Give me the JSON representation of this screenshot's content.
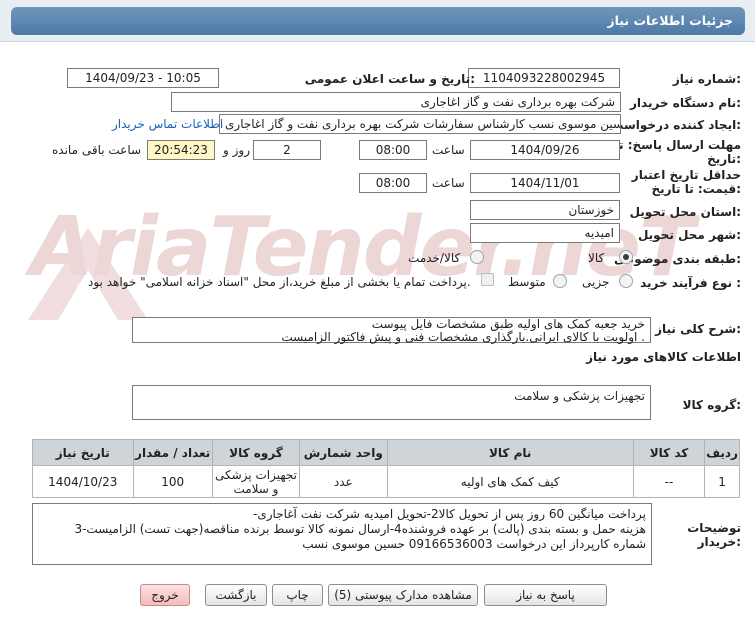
{
  "header": {
    "title": "جزئیات اطلاعات نیاز"
  },
  "watermark": {
    "text": "AriaTender.neT"
  },
  "form": {
    "need_number": {
      "label": "شماره نیاز:",
      "value": "1104093228002945"
    },
    "announce_datetime": {
      "label": "تاریخ و ساعت اعلان عمومی:",
      "value": "1404/09/23 - 10:05"
    },
    "buyer_org": {
      "label": "نام دستگاه خریدار:",
      "value": "شرکت بهره برداری نفت و گاز اغاجاری"
    },
    "requester": {
      "label": "ایجاد کننده درخواست:",
      "value": "حسین موسوی نسب کارشناس سفارشات شرکت بهره برداری نفت و گاز اغاجاری",
      "contact_link": "اطلاعات تماس خریدار"
    },
    "reply_deadline": {
      "label_line1": "مهلت ارسال پاسخ: تا",
      "label_line2": "تاریخ:",
      "date": "1404/09/26",
      "time_label": "ساعت",
      "time": "08:00",
      "days": "2",
      "days_label": "روز و",
      "remaining": "20:54:23",
      "remaining_label": "ساعت باقی مانده"
    },
    "price_validity": {
      "label_line1": "حداقل تاریخ اعتبار",
      "label_line2": "قیمت: تا تاریخ:",
      "date": "1404/11/01",
      "time_label": "ساعت",
      "time": "08:00"
    },
    "delivery_province": {
      "label": "استان محل تحویل:",
      "value": "خوزستان"
    },
    "delivery_city": {
      "label": "شهر محل تحویل:",
      "value": "امیدیه"
    },
    "category": {
      "label": "طبقه بندی موضوعی:",
      "options": [
        "کالا",
        "کالا/خدمت"
      ],
      "selected": "کالا"
    },
    "purchase_type": {
      "label": "نوع فرآیند خرید :",
      "options": [
        "جزیی",
        "متوسط"
      ],
      "selected": "",
      "note": "پرداخت تمام یا بخشی از مبلغ خرید،از محل \"اسناد خزانه اسلامی\" خواهد بود."
    }
  },
  "summary": {
    "label": "شرح کلی نیاز:",
    "line1": "خرید جعبه کمک های اولیه  طبق مشخصات فایل پیوست",
    "line2": "اولویت با کالای ایرانی.بارگذاری مشخصات فنی و پیش فاکتور الزامیست ."
  },
  "goods_info": {
    "title": "اطلاعات کالاهای مورد نیاز"
  },
  "goods_group": {
    "label": "گروه کالا:",
    "value": "تجهیزات پزشکی و سلامت"
  },
  "table": {
    "headers": [
      "ردیف",
      "کد کالا",
      "نام کالا",
      "واحد شمارش",
      "گروه کالا",
      "تعداد / مقدار",
      "تاریخ نیاز"
    ],
    "rows": [
      {
        "row": "1",
        "code": "--",
        "name": "کیف کمک های اولیه",
        "unit": "عدد",
        "group": "تجهیزات پزشکی و سلامت",
        "qty": "100",
        "date": "1404/10/23"
      }
    ]
  },
  "buyer_notes": {
    "label_line1": "توضیحات",
    "label_line2": "خریدار:",
    "line1": "-پرداخت میانگین 60 روز پس از تحویل کالا2-تحویل امیدیه شرکت نفت آغاجاری",
    "line2": "3-هزینه حمل  و بسته بندی (پالت) بر عهده فروشنده4-ارسال نمونه کالا توسط برنده مناقصه(جهت تست) الزامیست",
    "line3": "شماره کارپرداز این درخواست 09166536003 حسین موسوی نسب"
  },
  "buttons": {
    "reply": "پاسخ به نیاز",
    "attachments": "مشاهده مدارک پیوستی (5)",
    "print": "چاپ",
    "back": "بازگشت",
    "exit": "خروج"
  }
}
